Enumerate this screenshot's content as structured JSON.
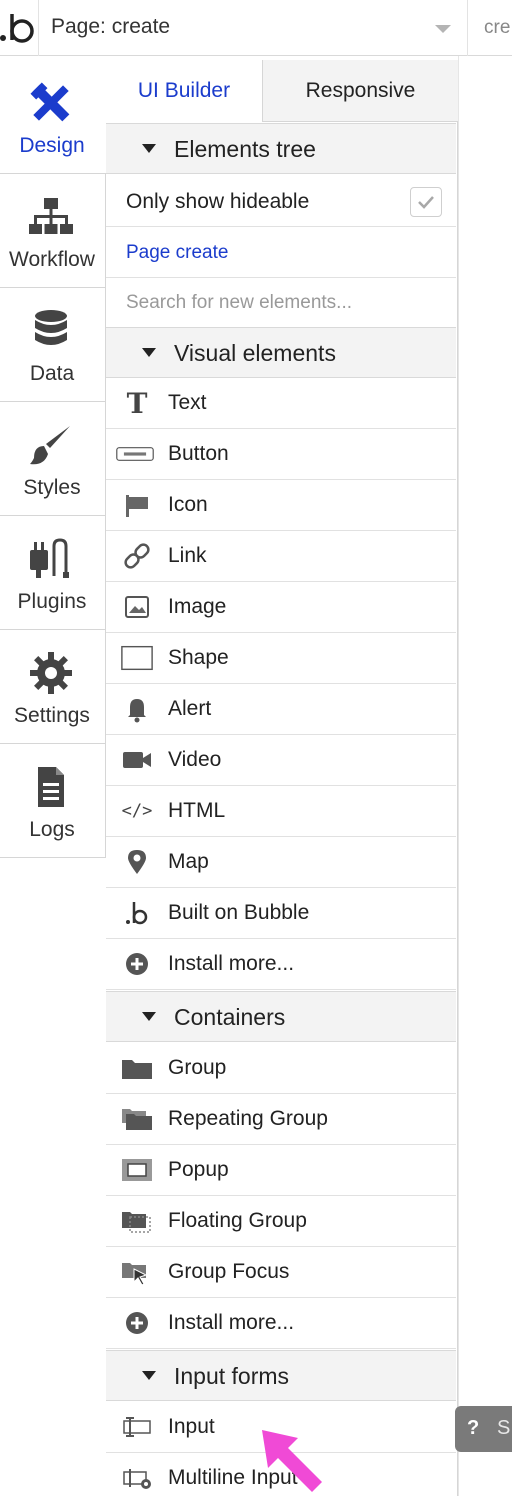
{
  "topbar": {
    "page_label": "Page: create",
    "right_label": "cre"
  },
  "nav": {
    "items": [
      {
        "label": "Design",
        "icon": "design-icon",
        "active": true
      },
      {
        "label": "Workflow",
        "icon": "workflow-icon"
      },
      {
        "label": "Data",
        "icon": "database-icon"
      },
      {
        "label": "Styles",
        "icon": "brush-icon"
      },
      {
        "label": "Plugins",
        "icon": "plugin-icon"
      },
      {
        "label": "Settings",
        "icon": "gear-icon"
      },
      {
        "label": "Logs",
        "icon": "document-icon"
      }
    ]
  },
  "panel": {
    "tabs": [
      "UI Builder",
      "Responsive"
    ],
    "elements_tree": "Elements tree",
    "only_show_hideable": "Only show hideable",
    "page_create": "Page create",
    "search_placeholder": "Search for new elements...",
    "visual_elements": {
      "title": "Visual elements",
      "items": [
        "Text",
        "Button",
        "Icon",
        "Link",
        "Image",
        "Shape",
        "Alert",
        "Video",
        "HTML",
        "Map",
        "Built on Bubble",
        "Install more..."
      ]
    },
    "containers": {
      "title": "Containers",
      "items": [
        "Group",
        "Repeating Group",
        "Popup",
        "Floating Group",
        "Group Focus",
        "Install more..."
      ]
    },
    "input_forms": {
      "title": "Input forms",
      "items": [
        "Input",
        "Multiline Input"
      ]
    }
  },
  "help": {
    "q": "?",
    "s": "S"
  },
  "colors": {
    "accent": "#1b3ccc",
    "cursor": "#f04ad6",
    "section_bg": "#f3f3f3"
  }
}
